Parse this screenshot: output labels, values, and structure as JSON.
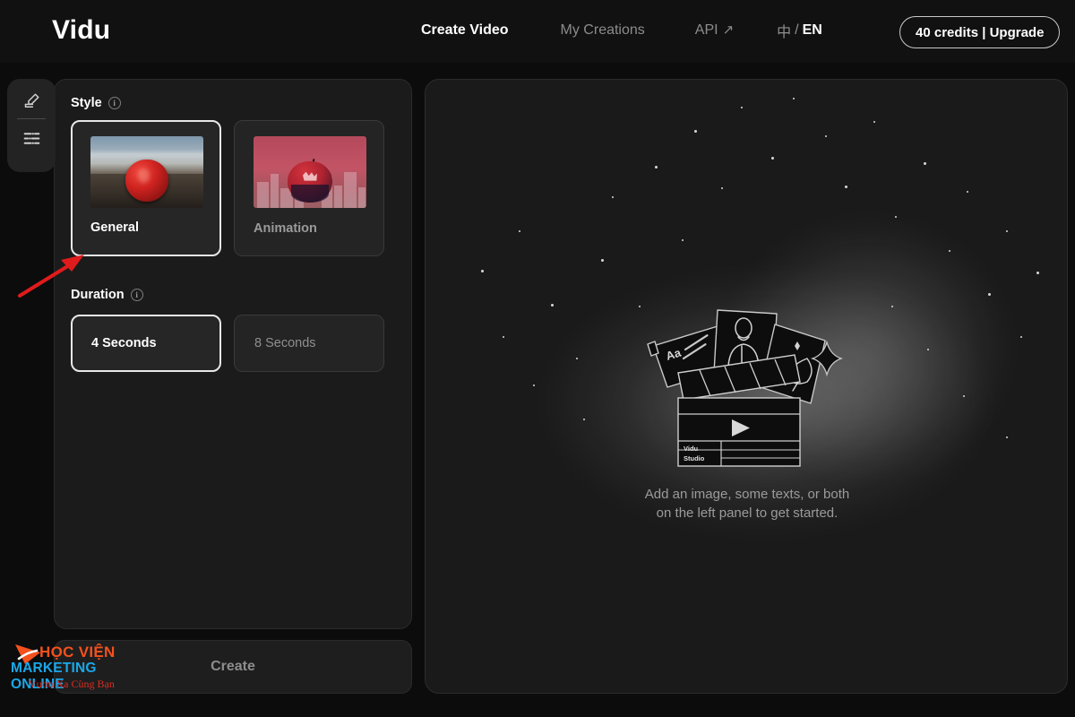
{
  "app": {
    "logo": "Vidu"
  },
  "header": {
    "nav": [
      {
        "label": "Create Video",
        "active": true,
        "icon": ""
      },
      {
        "label": "My Creations",
        "active": false,
        "icon": ""
      },
      {
        "label": "API",
        "active": false,
        "icon": "external-link-arrow"
      }
    ],
    "language": {
      "zh": "中",
      "separator": "/",
      "en": "EN"
    },
    "credits_button": "40 credits | Upgrade"
  },
  "rail": {
    "items": [
      {
        "icon": "edit-pen-icon",
        "name": "compose"
      },
      {
        "icon": "sliders-icon",
        "name": "settings"
      }
    ]
  },
  "left_panel": {
    "style": {
      "label": "Style",
      "info": "i",
      "options": [
        {
          "label": "General",
          "selected": true,
          "thumb": "photo-apple-field"
        },
        {
          "label": "Animation",
          "selected": false,
          "thumb": "illustration-apple-city"
        }
      ]
    },
    "duration": {
      "label": "Duration",
      "info": "i",
      "options": [
        {
          "label": "4 Seconds",
          "selected": true
        },
        {
          "label": "8 Seconds",
          "selected": false
        }
      ]
    }
  },
  "create_button": {
    "label": "Create",
    "enabled": false
  },
  "preview": {
    "illustration": {
      "name": "vidu-studio-clapperboard",
      "slate_label_line1": "Vidu",
      "slate_label_line2": "Studio",
      "card_text": "Aa"
    },
    "empty_state_line1": "Add an image, some texts, or both",
    "empty_state_line2": "on the left panel to get started."
  },
  "annotation": {
    "arrow": {
      "color": "#e01b1b",
      "points_to": "general-style-card"
    }
  },
  "watermark": {
    "line1": "HỌC VIỆN",
    "line2": "MARKETING ONLINE",
    "line3": "Vươn Xa Cùng Bạn",
    "colors": {
      "line1": "#f4511e",
      "line2": "#1aa7e8",
      "line3": "#e02b20"
    }
  },
  "colors": {
    "background": "#0c0c0c",
    "panel": "#1b1b1b",
    "card": "#242424",
    "selected_border": "#e8e8e8",
    "text_muted": "#8f8f8f",
    "accent_red": "#e01b1b"
  }
}
